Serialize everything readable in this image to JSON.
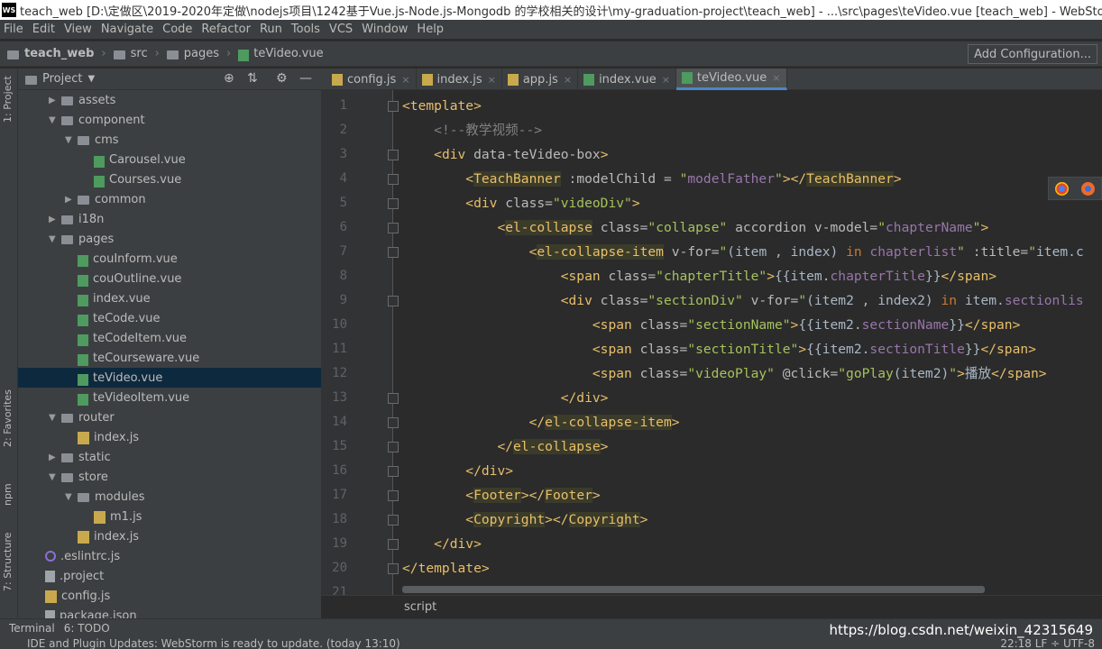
{
  "titlebar": {
    "text": "teach_web [D:\\定做区\\2019-2020年定做\\nodejs项目\\1242基于Vue.js-Node.js-Mongodb 的学校相关的设计\\my-graduation-project\\teach_web] - ...\\src\\pages\\teVideo.vue [teach_web] - WebStorm (A"
  },
  "menu": [
    "File",
    "Edit",
    "View",
    "Navigate",
    "Code",
    "Refactor",
    "Run",
    "Tools",
    "VCS",
    "Window",
    "Help"
  ],
  "breadcrumb": [
    "teach_web",
    "src",
    "pages",
    "teVideo.vue"
  ],
  "add_config": "Add Configuration...",
  "side_tabs": {
    "project": "1: Project",
    "favorites": "2: Favorites",
    "npm": "npm",
    "structure": "7: Structure"
  },
  "project_panel": {
    "title": "Project"
  },
  "tree": [
    {
      "label": "assets",
      "type": "folder",
      "open": false
    },
    {
      "label": "component",
      "type": "folder",
      "open": true
    },
    {
      "label": "cms",
      "type": "folder",
      "open": true
    },
    {
      "label": "Carousel.vue",
      "type": "vue"
    },
    {
      "label": "Courses.vue",
      "type": "vue"
    },
    {
      "label": "common",
      "type": "folder",
      "open": false
    },
    {
      "label": "i18n",
      "type": "folder",
      "open": false
    },
    {
      "label": "pages",
      "type": "folder",
      "open": true
    },
    {
      "label": "couInform.vue",
      "type": "vue"
    },
    {
      "label": "couOutline.vue",
      "type": "vue"
    },
    {
      "label": "index.vue",
      "type": "vue"
    },
    {
      "label": "teCode.vue",
      "type": "vue"
    },
    {
      "label": "teCodeItem.vue",
      "type": "vue"
    },
    {
      "label": "teCourseware.vue",
      "type": "vue"
    },
    {
      "label": "teVideo.vue",
      "type": "vue",
      "selected": true
    },
    {
      "label": "teVideoItem.vue",
      "type": "vue"
    },
    {
      "label": "router",
      "type": "folder",
      "open": true
    },
    {
      "label": "index.js",
      "type": "js"
    },
    {
      "label": "static",
      "type": "folder",
      "open": false
    },
    {
      "label": "store",
      "type": "folder",
      "open": true
    },
    {
      "label": "modules",
      "type": "folder",
      "open": true
    },
    {
      "label": "m1.js",
      "type": "js"
    },
    {
      "label": "index.js",
      "type": "js"
    },
    {
      "label": ".eslintrc.js",
      "type": "dot"
    },
    {
      "label": ".project",
      "type": "plain"
    },
    {
      "label": "config.js",
      "type": "js"
    },
    {
      "label": "package.json",
      "type": "plain"
    }
  ],
  "tabs": [
    {
      "label": "config.js",
      "close": "×"
    },
    {
      "label": "index.js",
      "close": "×"
    },
    {
      "label": "app.js",
      "close": "×"
    },
    {
      "label": "index.vue",
      "close": "×"
    },
    {
      "label": "teVideo.vue",
      "close": "×",
      "active": true
    }
  ],
  "code_lines": [
    {
      "n": "1",
      "html": "<span class='tg'>&lt;template&gt;</span>"
    },
    {
      "n": "2",
      "html": "    <span class='cm'>&lt;!--教学视频--&gt;</span>"
    },
    {
      "n": "3",
      "html": "    <span class='tg'>&lt;div </span><span class='at'>data-teVideo-box</span><span class='tg'>&gt;</span>"
    },
    {
      "n": "4",
      "html": "        <span class='tg'>&lt;<span class='hl'>TeachBanner</span> </span><span class='at'>:modelChild = </span><span class='sv'>\"</span><span class='id'>modelFather</span><span class='sv'>\"</span><span class='tg'>&gt;&lt;/<span class='hl'>TeachBanner</span>&gt;</span>"
    },
    {
      "n": "5",
      "html": "        <span class='tg'>&lt;div </span><span class='at'>class=</span><span class='sv'>\"videoDiv\"</span><span class='tg'>&gt;</span>"
    },
    {
      "n": "6",
      "html": "            <span class='tg'>&lt;<span class='hl'>el-collapse</span> </span><span class='at'>class=</span><span class='sv'>\"collapse\"</span><span class='at'> accordion v-model=</span><span class='sv'>\"</span><span class='id'>chapterName</span><span class='sv'>\"</span><span class='tg'>&gt;</span>"
    },
    {
      "n": "7",
      "html": "                <span class='tg'>&lt;<span class='hl'>el-collapse-item</span> </span><span class='at'>v-for=</span><span class='sv'>\"</span>(item , index) <span class='kw'>in</span> <span class='id'>chapterlist</span><span class='sv'>\"</span><span class='at'> :title=</span><span class='sv'>\"</span>item.c"
    },
    {
      "n": "8",
      "html": "                    <span class='tg'>&lt;span </span><span class='at'>class=</span><span class='sv'>\"chapterTitle\"</span><span class='tg'>&gt;</span>{{item.<span class='id'>chapterTitle</span>}}<span class='tg'>&lt;/span&gt;</span>"
    },
    {
      "n": "9",
      "html": "                    <span class='tg'>&lt;div </span><span class='at'>class=</span><span class='sv'>\"sectionDiv\"</span><span class='at'> v-for=</span><span class='sv'>\"</span>(item2 , index2) <span class='kw'>in</span> item.<span class='id'>sectionlis</span>"
    },
    {
      "n": "10",
      "html": "                        <span class='tg'>&lt;span </span><span class='at'>class=</span><span class='sv'>\"sectionName\"</span><span class='tg'>&gt;</span>{{item2.<span class='id'>sectionName</span>}}<span class='tg'>&lt;/span&gt;</span>"
    },
    {
      "n": "11",
      "html": "                        <span class='tg'>&lt;span </span><span class='at'>class=</span><span class='sv'>\"sectionTitle\"</span><span class='tg'>&gt;</span>{{item2.<span class='id'>sectionTitle</span>}}<span class='tg'>&lt;/span&gt;</span>"
    },
    {
      "n": "12",
      "html": "                        <span class='tg'>&lt;span </span><span class='at'>class=</span><span class='sv'>\"videoPlay\"</span><span class='at'> @click=</span><span class='sv'>\"goPlay</span>(item2)<span class='sv'>\"</span><span class='tg'>&gt;</span>播放<span class='tg'>&lt;/span&gt;</span>"
    },
    {
      "n": "13",
      "html": "                    <span class='tg'>&lt;/div&gt;</span>"
    },
    {
      "n": "14",
      "html": "                <span class='tg'>&lt;/<span class='hl'>el-collapse-item</span>&gt;</span>"
    },
    {
      "n": "15",
      "html": "            <span class='tg'>&lt;/<span class='hl'>el-collapse</span>&gt;</span>"
    },
    {
      "n": "16",
      "html": "        <span class='tg'>&lt;/div&gt;</span>"
    },
    {
      "n": "17",
      "html": "        <span class='tg'>&lt;<span class='hl'>Footer</span>&gt;&lt;/<span class='hl'>Footer</span>&gt;</span>"
    },
    {
      "n": "18",
      "html": "        <span class='tg'>&lt;<span class='hl'>Copyright</span>&gt;&lt;/<span class='hl'>Copyright</span>&gt;</span>"
    },
    {
      "n": "19",
      "html": "    <span class='tg'>&lt;/div&gt;</span>"
    },
    {
      "n": "20",
      "html": "<span class='tg'>&lt;/template&gt;</span>"
    },
    {
      "n": "21",
      "html": ""
    }
  ],
  "editor_breadcrumb": "script",
  "bottom_tools": [
    "Terminal",
    "6: TODO"
  ],
  "status": {
    "message": "IDE and Plugin Updates: WebStorm is ready to update. (today 13:10)",
    "right": "22:18  LF ÷  UTF-8"
  },
  "watermark": "https://blog.csdn.net/weixin_42315649"
}
